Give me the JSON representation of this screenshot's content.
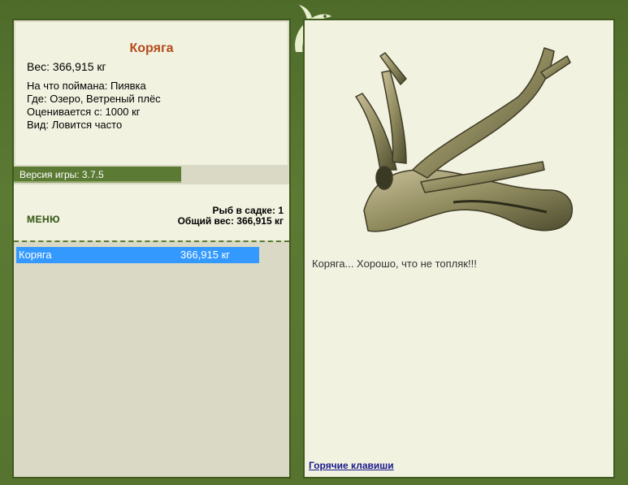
{
  "fish": {
    "name": "Коряга",
    "weight_line": "Вес: 366,915 кг",
    "bait_line": "На что поймана: Пиявка",
    "location_line": "Где: Озеро, Ветреный плёс",
    "value_line": "Оценивается с: 1000 кг",
    "kind_line": "Вид: Ловится часто"
  },
  "version": "Версия игры: 3.7.5",
  "menu_label": "МЕНЮ",
  "keepnet": {
    "count_line": "Рыб в садке: 1",
    "total_line": "Общий вес: 366,915 кг",
    "items": [
      {
        "name": "Коряга",
        "weight": "366,915 кг"
      }
    ]
  },
  "description": "Коряга... Хорошо, что не топляк!!!",
  "hotkeys_label": "Горячие клавиши",
  "colors": {
    "frame": "#5c7a34",
    "panel": "#f2f2e1",
    "list_bg": "#d9d9c5",
    "title": "#b34a1a",
    "selection": "#3399ff"
  },
  "icons": [
    "fish-logo-icon",
    "driftwood-image"
  ]
}
